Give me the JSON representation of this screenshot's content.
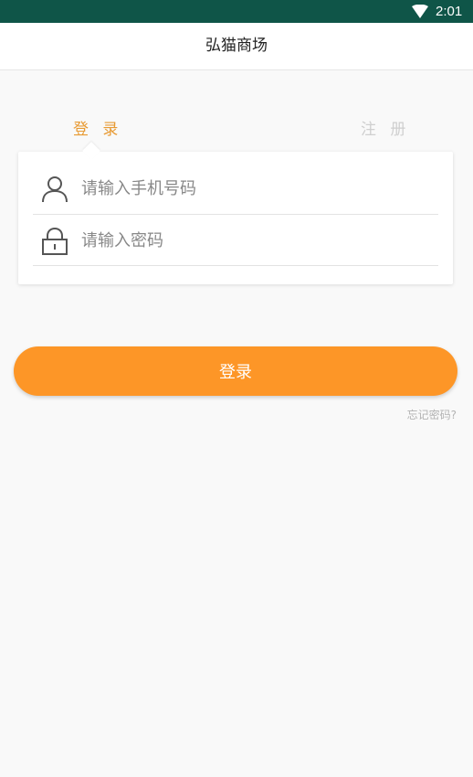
{
  "status_bar": {
    "time": "2:01",
    "wifi_icon": "wifi-icon",
    "background_color": "#0f5548"
  },
  "header": {
    "title": "弘猫商场"
  },
  "tabs": [
    {
      "label": "登 录",
      "active": true,
      "color": "#e89a33"
    },
    {
      "label": "注 册",
      "active": false,
      "color": "#cfcfcf"
    }
  ],
  "form": {
    "phone": {
      "icon": "user-icon",
      "placeholder": "请输入手机号码",
      "value": ""
    },
    "password": {
      "icon": "lock-icon",
      "placeholder": "请输入密码",
      "value": ""
    }
  },
  "login_button": {
    "label": "登录",
    "color": "#fd9627"
  },
  "forgot_link": {
    "label": "忘记密码?"
  }
}
